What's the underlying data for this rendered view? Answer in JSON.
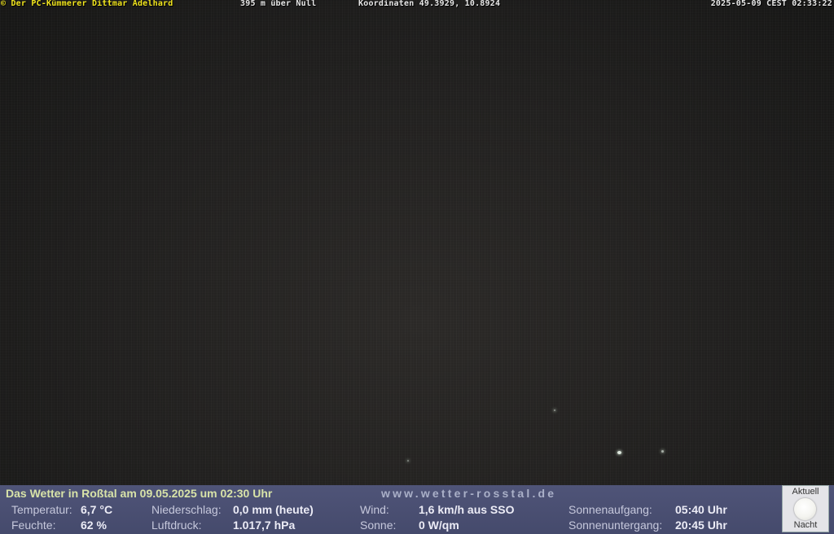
{
  "overlay": {
    "credit": "© Der PC-Kümmerer Dittmar Adelhard",
    "altitude": "395 m über Null",
    "coordinates": "Koordinaten 49.3929, 10.8924",
    "timestamp": "2025-05-09 CEST 02:33:22"
  },
  "weather": {
    "headline": "Das Wetter in Roßtal am 09.05.2025 um 02:30 Uhr",
    "site": "www.wetter-rosstal.de",
    "rows": [
      {
        "temperature_label": "Temperatur:",
        "temperature_value": "6,7 °C",
        "precip_label": "Niederschlag:",
        "precip_value": "0,0 mm (heute)",
        "wind_label": "Wind:",
        "wind_value": "1,6 km/h aus SSO",
        "sun_label": "Sonnenaufgang:",
        "sun_value": "05:40 Uhr"
      },
      {
        "humidity_label": "Feuchte:",
        "humidity_value": "62 %",
        "pressure_label": "Luftdruck:",
        "pressure_value": "1.017,7 hPa",
        "solar_label": "Sonne:",
        "solar_value": "0 W/qm",
        "sunset_label": "Sonnenuntergang:",
        "sunset_value": "20:45 Uhr"
      }
    ],
    "moon": {
      "top_label": "Aktuell",
      "bottom_label": "Nacht",
      "icon": "full-moon-icon"
    }
  }
}
